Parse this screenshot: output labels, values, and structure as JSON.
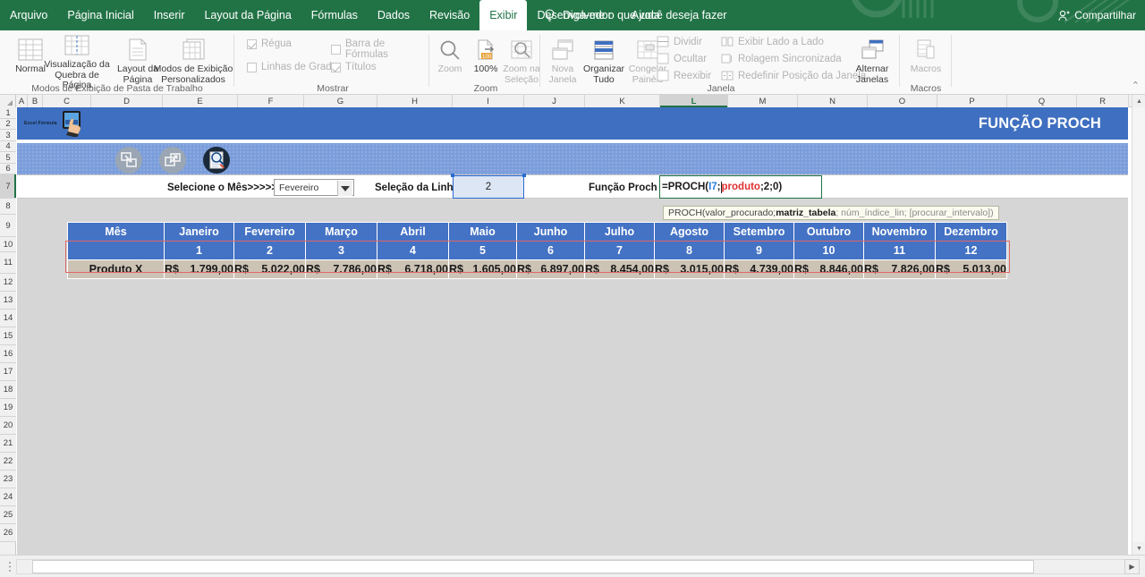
{
  "titlebar": {
    "menu": [
      {
        "label": "Arquivo",
        "active": false
      },
      {
        "label": "Página Inicial",
        "active": false
      },
      {
        "label": "Inserir",
        "active": false
      },
      {
        "label": "Layout da Página",
        "active": false
      },
      {
        "label": "Fórmulas",
        "active": false
      },
      {
        "label": "Dados",
        "active": false
      },
      {
        "label": "Revisão",
        "active": false
      },
      {
        "label": "Exibir",
        "active": true
      },
      {
        "label": "Desenvolvedor",
        "active": false
      },
      {
        "label": "Ajuda",
        "active": false
      }
    ],
    "tell_me": "Diga-me o que você deseja fazer",
    "share": "Compartilhar",
    "brand_color": "#217346"
  },
  "ribbon": {
    "groups": [
      {
        "label": "Modos de Exibição de Pasta de Trabalho"
      },
      {
        "label": "Mostrar"
      },
      {
        "label": "Zoom"
      },
      {
        "label": "Janela"
      },
      {
        "label": "Macros"
      }
    ],
    "view_buttons": [
      {
        "label": "Normal",
        "enabled": true
      },
      {
        "label": "Visualização da Quebra de Página",
        "enabled": true
      },
      {
        "label": "Layout da Página",
        "enabled": true
      },
      {
        "label": "Modos de Exibição Personalizados",
        "enabled": true
      }
    ],
    "show_checks": [
      {
        "label": "Régua",
        "checked": true
      },
      {
        "label": "Barra de Fórmulas",
        "checked": false
      },
      {
        "label": "Linhas de Grade",
        "checked": false
      },
      {
        "label": "Títulos",
        "checked": true
      }
    ],
    "zoom_buttons": [
      {
        "label": "Zoom"
      },
      {
        "label": "100%"
      },
      {
        "label": "Zoom na Seleção"
      }
    ],
    "window_buttons": [
      {
        "label": "Nova Janela",
        "enabled": false
      },
      {
        "label": "Organizar Tudo",
        "enabled": true
      },
      {
        "label": "Congelar Painéis",
        "enabled": false
      }
    ],
    "window_small": [
      {
        "label": "Dividir"
      },
      {
        "label": "Ocultar"
      },
      {
        "label": "Reexibir"
      },
      {
        "label": "Exibir Lado a Lado"
      },
      {
        "label": "Rolagem Sincronizada"
      },
      {
        "label": "Redefinir Posição da Janela"
      }
    ],
    "switch_windows": "Alternar Janelas",
    "macros": "Macros",
    "collapse": "⌃"
  },
  "sheet": {
    "columns": [
      "A",
      "B",
      "C",
      "D",
      "E",
      "F",
      "G",
      "H",
      "I",
      "J",
      "K",
      "L",
      "M",
      "N",
      "O",
      "P",
      "Q",
      "R"
    ],
    "active_column": "L",
    "rows": [
      "1",
      "2",
      "3",
      "4",
      "5",
      "6",
      "7",
      "8",
      "9",
      "10",
      "11",
      "12",
      "13",
      "14",
      "15",
      "16",
      "17",
      "18",
      "19",
      "20",
      "21",
      "22",
      "23",
      "24",
      "25",
      "26"
    ],
    "active_row": "7"
  },
  "banner": {
    "title": "FUNÇÃO PROCH",
    "logo_text": "Excel Fórmula",
    "color": "#3f6fc0",
    "icons": [
      {
        "name": "collapse-arrows-icon"
      },
      {
        "name": "expand-arrows-icon"
      },
      {
        "name": "search-document-icon"
      }
    ]
  },
  "controls": {
    "month_label": "Selecione o Mês>>>>>>",
    "month_value": "Fevereiro",
    "month_options": [
      "Janeiro",
      "Fevereiro",
      "Março",
      "Abril",
      "Maio",
      "Junho",
      "Julho",
      "Agosto",
      "Setembro",
      "Outubro",
      "Novembro",
      "Dezembro"
    ],
    "row_label": "Seleção da Linha >",
    "row_value": "2",
    "formula_label": "Função Proch >>",
    "formula_prefix": "=PROCH(",
    "formula_arg1": "I7",
    "formula_sep1": ";",
    "formula_arg2": "produto",
    "formula_suffix": ";2;0)",
    "tooltip_prefix": "PROCH(valor_procurado; ",
    "tooltip_bold": "matriz_tabela",
    "tooltip_suffix": "; núm_índice_lin; [procurar_intervalo])"
  },
  "chart_data": {
    "type": "table",
    "title": "FUNÇÃO PROCH",
    "header_label": "Mês",
    "row_label": "Produto X",
    "categories": [
      "Janeiro",
      "Fevereiro",
      "Março",
      "Abril",
      "Maio",
      "Junho",
      "Julho",
      "Agosto",
      "Setembro",
      "Outubro",
      "Novembro",
      "Dezembro"
    ],
    "index_row": [
      "1",
      "2",
      "3",
      "4",
      "5",
      "6",
      "7",
      "8",
      "9",
      "10",
      "11",
      "12"
    ],
    "currency": "R$",
    "values": [
      1799.0,
      5022.0,
      7786.0,
      6718.0,
      1605.0,
      6897.0,
      8454.0,
      3015.0,
      4739.0,
      8846.0,
      7826.0,
      5013.0
    ],
    "values_formatted": [
      "1.799,00",
      "5.022,00",
      "7.786,00",
      "6.718,00",
      "1.605,00",
      "6.897,00",
      "8.454,00",
      "3.015,00",
      "4.739,00",
      "8.846,00",
      "7.826,00",
      "5.013,00"
    ],
    "header_color": "#4472c4",
    "data_row_color": "#cdc3b5",
    "selection_color": "#e06666"
  }
}
